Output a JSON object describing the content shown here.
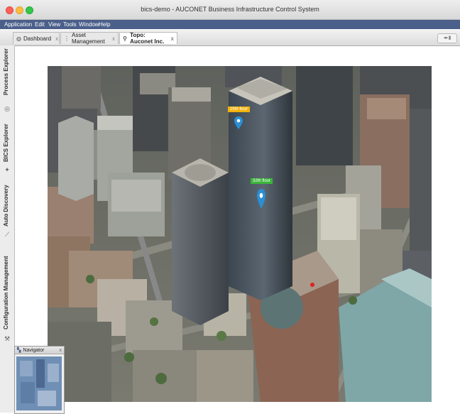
{
  "window": {
    "title": "bics-demo - AUCONET Business Infrastructure Control System"
  },
  "menubar": {
    "items": [
      "Application",
      "Edit",
      "View",
      "Tools",
      "Window",
      "Help"
    ]
  },
  "tabs": [
    {
      "label": "Dashboard",
      "icon": "globe-icon",
      "active": false
    },
    {
      "label": "Asset Management",
      "icon": "grid-icon",
      "active": false
    },
    {
      "label": "Topo: Auconet Inc.",
      "icon": "topology-icon",
      "active": true
    }
  ],
  "sidebar": {
    "items": [
      {
        "label": "Process Explorer",
        "icon": "process-icon"
      },
      {
        "label": "BICS Explorer",
        "icon": "compass-icon"
      },
      {
        "label": "Auto Discovery",
        "icon": "wand-icon"
      },
      {
        "label": "Configuration Management",
        "icon": "tools-icon"
      }
    ]
  },
  "map": {
    "markers": [
      {
        "label": "25th floor",
        "color": "#f2b20c",
        "pin_color": "#2b8fd6"
      },
      {
        "label": "32th floor",
        "color": "#3ab53a",
        "pin_color": "#2b8fd6"
      },
      {
        "label": "",
        "color": "#e02020"
      }
    ]
  },
  "navigator": {
    "title": "Navigator",
    "close": "x"
  },
  "close_symbol": "x"
}
